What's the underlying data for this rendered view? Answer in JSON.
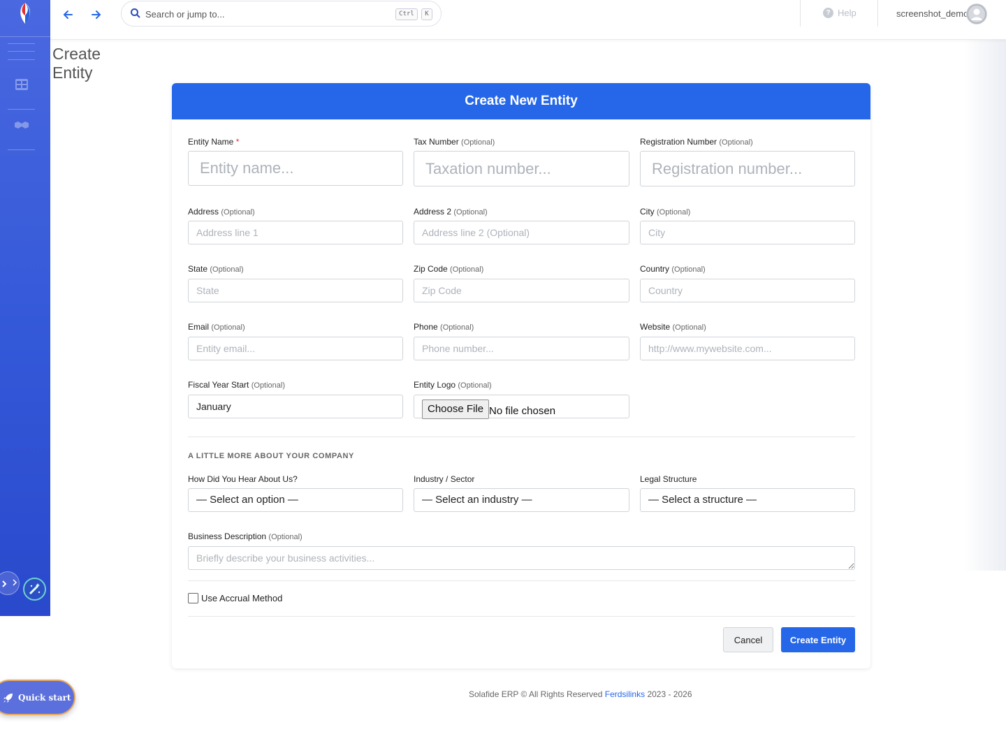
{
  "topbar": {
    "search_placeholder": "Search or jump to...",
    "kbd_ctrl": "Ctrl",
    "kbd_k": "K",
    "help": "Help",
    "username": "screenshot_demo"
  },
  "page": {
    "title": "Create Entity"
  },
  "form": {
    "header": "Create New Entity",
    "optional": "(Optional)",
    "fields": {
      "entity_name": {
        "label": "Entity Name",
        "required": "*",
        "placeholder": "Entity name..."
      },
      "tax_number": {
        "label": "Tax Number",
        "placeholder": "Taxation number..."
      },
      "registration_number": {
        "label": "Registration Number",
        "placeholder": "Registration number..."
      },
      "address": {
        "label": "Address",
        "placeholder": "Address line 1"
      },
      "address2": {
        "label": "Address 2",
        "placeholder": "Address line 2 (Optional)"
      },
      "city": {
        "label": "City",
        "placeholder": "City"
      },
      "state": {
        "label": "State",
        "placeholder": "State"
      },
      "zip": {
        "label": "Zip Code",
        "placeholder": "Zip Code"
      },
      "country": {
        "label": "Country",
        "placeholder": "Country"
      },
      "email": {
        "label": "Email",
        "placeholder": "Entity email..."
      },
      "phone": {
        "label": "Phone",
        "placeholder": "Phone number..."
      },
      "website": {
        "label": "Website",
        "placeholder": "http://www.mywebsite.com..."
      },
      "fiscal_year": {
        "label": "Fiscal Year Start",
        "value": "January"
      },
      "logo": {
        "label": "Entity Logo",
        "button": "Choose File",
        "status": "No file chosen"
      }
    },
    "section_title": "A LITTLE MORE ABOUT YOUR COMPANY",
    "more": {
      "hear": {
        "label": "How Did You Hear About Us?",
        "value": "— Select an option —"
      },
      "industry": {
        "label": "Industry / Sector",
        "value": "— Select an industry —"
      },
      "legal": {
        "label": "Legal Structure",
        "value": "— Select a structure —"
      },
      "description": {
        "label": "Business Description",
        "placeholder": "Briefly describe your business activities..."
      }
    },
    "accrual_label": "Use Accrual Method",
    "cancel": "Cancel",
    "submit": "Create Entity"
  },
  "footer": {
    "prefix": "Solafide ERP © All Rights Reserved",
    "link": "Ferdsilinks",
    "years": "2023 - 2026"
  },
  "quick_start": "Quick start",
  "colors": {
    "primary": "#2567e8",
    "sidebar": "#3358d8"
  }
}
